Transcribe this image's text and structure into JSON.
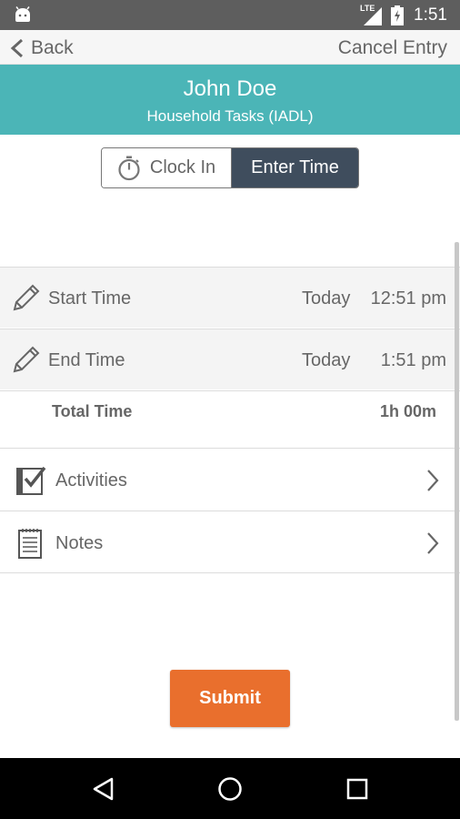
{
  "status_bar": {
    "network": "LTE",
    "time": "1:51",
    "icons": [
      "android-icon",
      "signal-icon",
      "battery-icon"
    ]
  },
  "nav": {
    "back_label": "Back",
    "cancel_label": "Cancel Entry"
  },
  "header": {
    "client_name": "John Doe",
    "task": "Household Tasks (IADL)",
    "color": "#4bb5b7"
  },
  "mode_toggle": {
    "options": [
      "Clock In",
      "Enter Time"
    ],
    "selected": "Enter Time"
  },
  "times": {
    "start": {
      "label": "Start Time",
      "day": "Today",
      "time": "12:51 pm"
    },
    "end": {
      "label": "End Time",
      "day": "Today",
      "time": "1:51 pm"
    },
    "total": {
      "label": "Total Time",
      "value": "1h 00m"
    }
  },
  "sections": [
    {
      "label": "Activities",
      "icon": "checklist-icon"
    },
    {
      "label": "Notes",
      "icon": "notes-icon"
    }
  ],
  "submit": {
    "label": "Submit",
    "color": "#e96f2d"
  },
  "system_nav": [
    "back-triangle-icon",
    "home-circle-icon",
    "recents-square-icon"
  ]
}
